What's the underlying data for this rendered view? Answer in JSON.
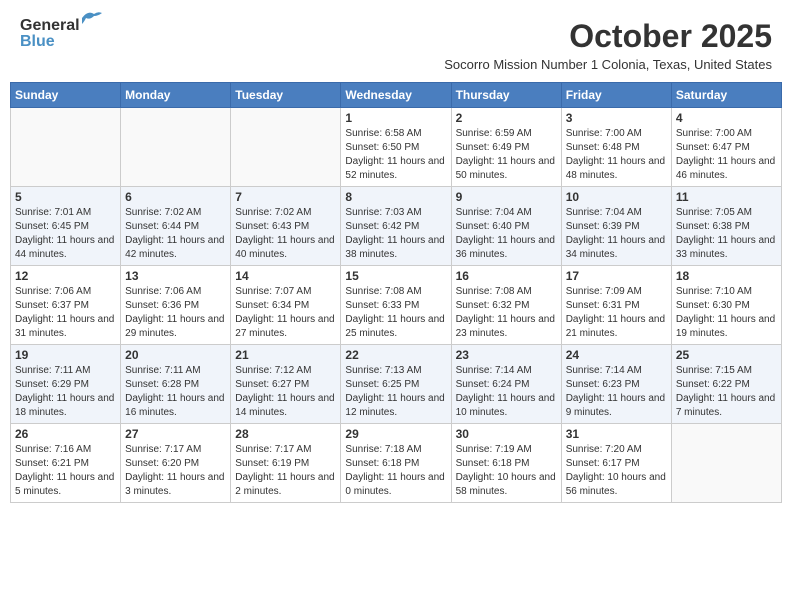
{
  "header": {
    "logo_general": "General",
    "logo_blue": "Blue",
    "month_title": "October 2025",
    "subtitle": "Socorro Mission Number 1 Colonia, Texas, United States"
  },
  "days_of_week": [
    "Sunday",
    "Monday",
    "Tuesday",
    "Wednesday",
    "Thursday",
    "Friday",
    "Saturday"
  ],
  "weeks": [
    [
      {
        "day": "",
        "content": ""
      },
      {
        "day": "",
        "content": ""
      },
      {
        "day": "",
        "content": ""
      },
      {
        "day": "1",
        "content": "Sunrise: 6:58 AM\nSunset: 6:50 PM\nDaylight: 11 hours and 52 minutes."
      },
      {
        "day": "2",
        "content": "Sunrise: 6:59 AM\nSunset: 6:49 PM\nDaylight: 11 hours and 50 minutes."
      },
      {
        "day": "3",
        "content": "Sunrise: 7:00 AM\nSunset: 6:48 PM\nDaylight: 11 hours and 48 minutes."
      },
      {
        "day": "4",
        "content": "Sunrise: 7:00 AM\nSunset: 6:47 PM\nDaylight: 11 hours and 46 minutes."
      }
    ],
    [
      {
        "day": "5",
        "content": "Sunrise: 7:01 AM\nSunset: 6:45 PM\nDaylight: 11 hours and 44 minutes."
      },
      {
        "day": "6",
        "content": "Sunrise: 7:02 AM\nSunset: 6:44 PM\nDaylight: 11 hours and 42 minutes."
      },
      {
        "day": "7",
        "content": "Sunrise: 7:02 AM\nSunset: 6:43 PM\nDaylight: 11 hours and 40 minutes."
      },
      {
        "day": "8",
        "content": "Sunrise: 7:03 AM\nSunset: 6:42 PM\nDaylight: 11 hours and 38 minutes."
      },
      {
        "day": "9",
        "content": "Sunrise: 7:04 AM\nSunset: 6:40 PM\nDaylight: 11 hours and 36 minutes."
      },
      {
        "day": "10",
        "content": "Sunrise: 7:04 AM\nSunset: 6:39 PM\nDaylight: 11 hours and 34 minutes."
      },
      {
        "day": "11",
        "content": "Sunrise: 7:05 AM\nSunset: 6:38 PM\nDaylight: 11 hours and 33 minutes."
      }
    ],
    [
      {
        "day": "12",
        "content": "Sunrise: 7:06 AM\nSunset: 6:37 PM\nDaylight: 11 hours and 31 minutes."
      },
      {
        "day": "13",
        "content": "Sunrise: 7:06 AM\nSunset: 6:36 PM\nDaylight: 11 hours and 29 minutes."
      },
      {
        "day": "14",
        "content": "Sunrise: 7:07 AM\nSunset: 6:34 PM\nDaylight: 11 hours and 27 minutes."
      },
      {
        "day": "15",
        "content": "Sunrise: 7:08 AM\nSunset: 6:33 PM\nDaylight: 11 hours and 25 minutes."
      },
      {
        "day": "16",
        "content": "Sunrise: 7:08 AM\nSunset: 6:32 PM\nDaylight: 11 hours and 23 minutes."
      },
      {
        "day": "17",
        "content": "Sunrise: 7:09 AM\nSunset: 6:31 PM\nDaylight: 11 hours and 21 minutes."
      },
      {
        "day": "18",
        "content": "Sunrise: 7:10 AM\nSunset: 6:30 PM\nDaylight: 11 hours and 19 minutes."
      }
    ],
    [
      {
        "day": "19",
        "content": "Sunrise: 7:11 AM\nSunset: 6:29 PM\nDaylight: 11 hours and 18 minutes."
      },
      {
        "day": "20",
        "content": "Sunrise: 7:11 AM\nSunset: 6:28 PM\nDaylight: 11 hours and 16 minutes."
      },
      {
        "day": "21",
        "content": "Sunrise: 7:12 AM\nSunset: 6:27 PM\nDaylight: 11 hours and 14 minutes."
      },
      {
        "day": "22",
        "content": "Sunrise: 7:13 AM\nSunset: 6:25 PM\nDaylight: 11 hours and 12 minutes."
      },
      {
        "day": "23",
        "content": "Sunrise: 7:14 AM\nSunset: 6:24 PM\nDaylight: 11 hours and 10 minutes."
      },
      {
        "day": "24",
        "content": "Sunrise: 7:14 AM\nSunset: 6:23 PM\nDaylight: 11 hours and 9 minutes."
      },
      {
        "day": "25",
        "content": "Sunrise: 7:15 AM\nSunset: 6:22 PM\nDaylight: 11 hours and 7 minutes."
      }
    ],
    [
      {
        "day": "26",
        "content": "Sunrise: 7:16 AM\nSunset: 6:21 PM\nDaylight: 11 hours and 5 minutes."
      },
      {
        "day": "27",
        "content": "Sunrise: 7:17 AM\nSunset: 6:20 PM\nDaylight: 11 hours and 3 minutes."
      },
      {
        "day": "28",
        "content": "Sunrise: 7:17 AM\nSunset: 6:19 PM\nDaylight: 11 hours and 2 minutes."
      },
      {
        "day": "29",
        "content": "Sunrise: 7:18 AM\nSunset: 6:18 PM\nDaylight: 11 hours and 0 minutes."
      },
      {
        "day": "30",
        "content": "Sunrise: 7:19 AM\nSunset: 6:18 PM\nDaylight: 10 hours and 58 minutes."
      },
      {
        "day": "31",
        "content": "Sunrise: 7:20 AM\nSunset: 6:17 PM\nDaylight: 10 hours and 56 minutes."
      },
      {
        "day": "",
        "content": ""
      }
    ]
  ]
}
